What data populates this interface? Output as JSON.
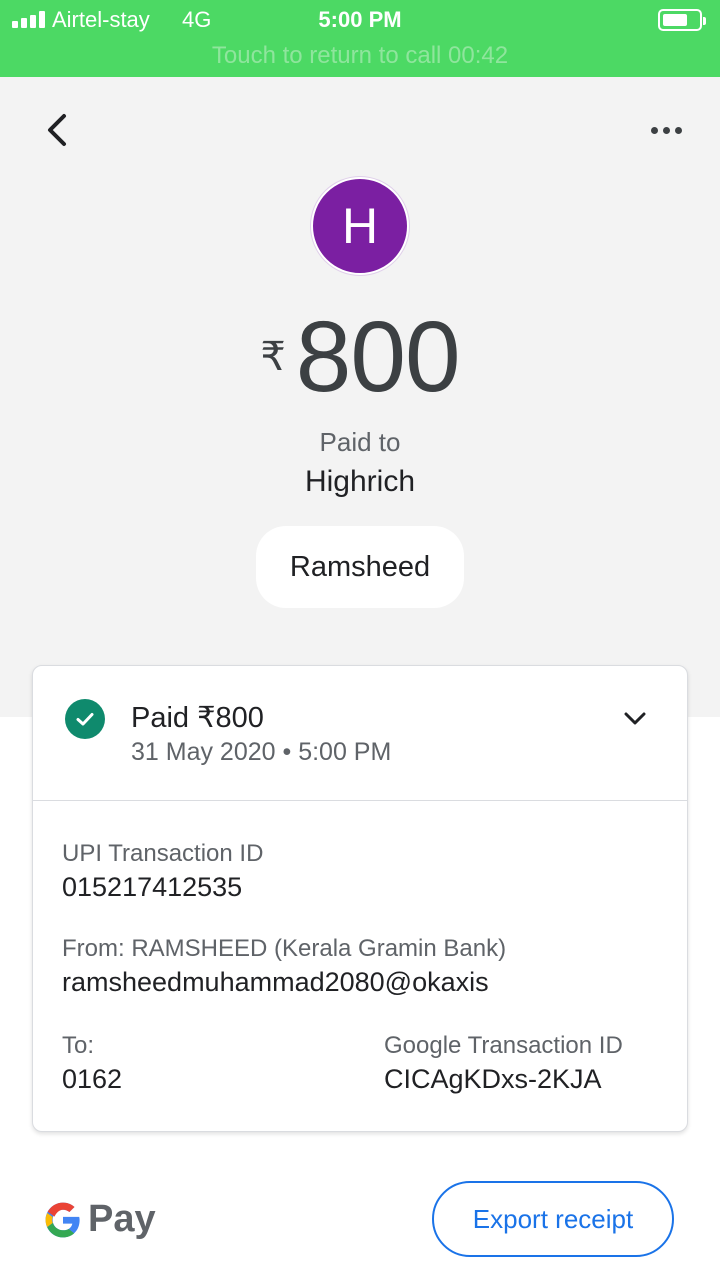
{
  "status_bar": {
    "carrier": "Airtel-stay",
    "network": "4G",
    "time": "5:00 PM",
    "battery_level": 0.7,
    "call_banner": "Touch to return to call 00:42"
  },
  "header": {
    "back_icon": "chevron-left-icon",
    "more_icon": "more-horizontal-icon"
  },
  "payee": {
    "avatar_initial": "H",
    "avatar_color": "#7b1fa2",
    "currency_symbol": "₹",
    "amount": "800",
    "paid_to_label": "Paid to",
    "name": "Highrich",
    "note": "Ramsheed"
  },
  "transaction": {
    "status_title": "Paid ₹800",
    "date_time": "31 May 2020 • 5:00 PM",
    "status_color": "#0f8a6d",
    "upi_id_label": "UPI Transaction ID",
    "upi_id": "015217412535",
    "from_label": "From: RAMSHEED (Kerala Gramin Bank)",
    "from_value": "ramsheedmuhammad2080@okaxis",
    "to_label": "To:",
    "to_value": "0162",
    "google_id_label": "Google Transaction ID",
    "google_id": "CICAgKDxs-2KJA"
  },
  "footer": {
    "brand": "Pay",
    "export_label": "Export receipt",
    "accent_color": "#1a73e8"
  }
}
